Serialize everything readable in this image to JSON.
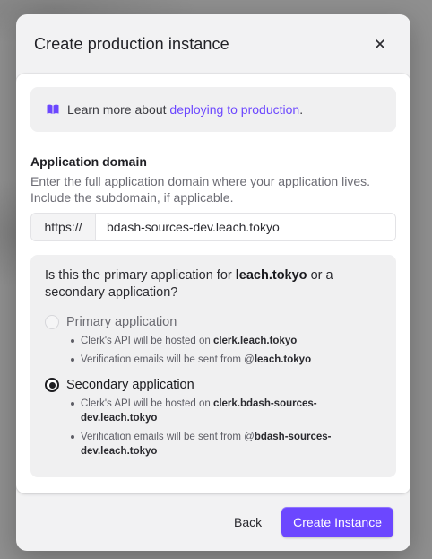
{
  "modal": {
    "title": "Create production instance",
    "close_label": "×"
  },
  "info": {
    "prefix": "Learn more about ",
    "link_text": "deploying to production",
    "suffix": ".",
    "icon": "book-open-icon",
    "accent_color": "#6c47ff"
  },
  "domain": {
    "label": "Application domain",
    "description": "Enter the full application domain where your application lives. Include the subdomain, if applicable.",
    "prefix": "https://",
    "value": "bdash-sources-dev.leach.tokyo"
  },
  "choice": {
    "question_prefix": "Is this the primary application for ",
    "question_domain": "leach.tokyo",
    "question_suffix": " or a secondary application?",
    "options": [
      {
        "label": "Primary application",
        "selected": false,
        "bullets": [
          {
            "text": "Clerk's API will be hosted on ",
            "bold": "clerk.leach.tokyo"
          },
          {
            "text": "Verification emails will be sent from @",
            "bold": "leach.tokyo"
          }
        ]
      },
      {
        "label": "Secondary application",
        "selected": true,
        "bullets": [
          {
            "text": "Clerk's API will be hosted on ",
            "bold": "clerk.bdash-sources-dev.leach.tokyo"
          },
          {
            "text": "Verification emails will be sent from @",
            "bold": "bdash-sources-dev.leach.tokyo"
          }
        ]
      }
    ]
  },
  "footer": {
    "back_label": "Back",
    "submit_label": "Create Instance"
  }
}
